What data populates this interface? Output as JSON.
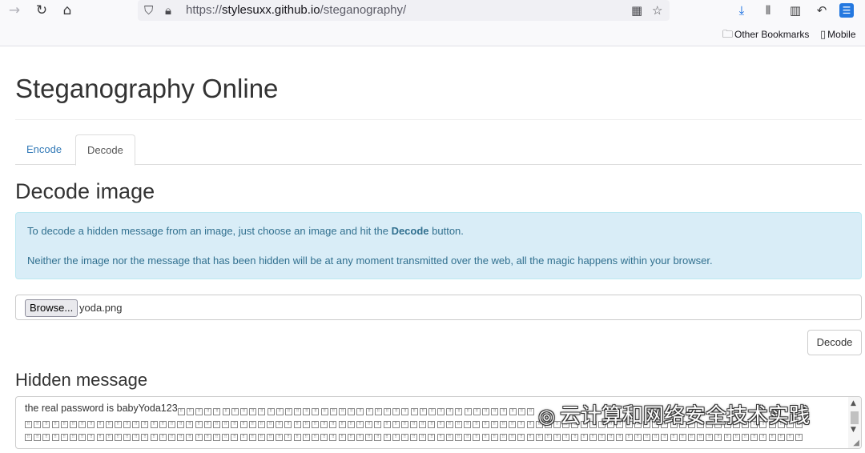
{
  "browser": {
    "back_icon": "arrow-right-icon",
    "url_prefix": "https://",
    "url_domain": "stylesuxx.github.io",
    "url_path": "/steganography/",
    "bookmarks": [
      {
        "label": "Other Bookmarks",
        "icon": "folder-icon"
      },
      {
        "label": "Mobile",
        "icon": "phone-icon"
      }
    ]
  },
  "page": {
    "title": "Steganography Online",
    "tabs": [
      {
        "label": "Encode",
        "active": false
      },
      {
        "label": "Decode",
        "active": true
      }
    ],
    "decode_heading": "Decode image",
    "info": {
      "line1_before": "To decode a hidden message from an image, just choose an image and hit the ",
      "line1_bold": "Decode",
      "line1_after": " button.",
      "line2": "Neither the image nor the message that has been hidden will be at any moment transmitted over the web, all the magic happens within your browser."
    },
    "file_input": {
      "browse_label": "Browse...",
      "file_name": "yoda.png"
    },
    "decode_button": "Decode",
    "hidden_heading": "Hidden message",
    "hidden_message": "the real password is babyYoda123"
  },
  "watermark": "云计算和网络安全技术实践"
}
